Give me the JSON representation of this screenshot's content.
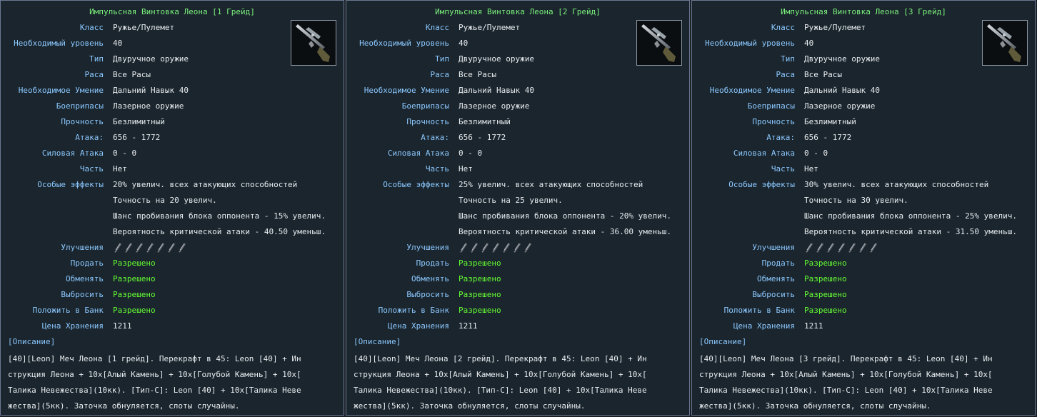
{
  "panels": [
    {
      "title": "Импульсная Винтовка Леона [1 Грейд]",
      "icon": "rifle-icon",
      "rows": [
        {
          "label": "Класс",
          "value": "Ружье/Пулемет"
        },
        {
          "label": "Необходимый уровень",
          "value": "40"
        },
        {
          "label": "Тип",
          "value": "Двуручное оружие"
        },
        {
          "label": "Раса",
          "value": "Все Расы"
        },
        {
          "label": "Необходимое Умение",
          "value": "Дальний Навык 40"
        },
        {
          "label": "Боеприпасы",
          "value": "Лазерное оружие"
        },
        {
          "label": "Прочность",
          "value": "Безлимитный"
        },
        {
          "label": "Атака:",
          "value": "656 - 1772"
        },
        {
          "label": "Силовая Атака",
          "value": "0 - 0"
        },
        {
          "label": "Часть",
          "value": "Нет"
        },
        {
          "label": "Особые эффекты",
          "value": "20% увелич. всех атакующих способностей"
        },
        {
          "label": "",
          "value": "Точность на 20 увелич."
        },
        {
          "label": "",
          "value": "Шанс пробивания блока оппонента - 15% увелич."
        },
        {
          "label": "",
          "value": "Вероятность критической атаки - 40.50 уменьш."
        }
      ],
      "upgrades_label": "Улучшения",
      "upgrade_slots": 7,
      "perm_rows": [
        {
          "label": "Продать",
          "value": "Разрешено"
        },
        {
          "label": "Обменять",
          "value": "Разрешено"
        },
        {
          "label": "Выбросить",
          "value": "Разрешено"
        },
        {
          "label": "Положить в Банк",
          "value": "Разрешено"
        }
      ],
      "storage": {
        "label": "Цена Хранения",
        "value": "1211"
      },
      "desc_header": "[Описание]",
      "desc_lines": [
        "[40][Leon] Меч Леона [1 грейд]. Перекрафт в 45: Leon [40] + Ин",
        "струкция Леона + 10x[Алый Камень] + 10x[Голубой Камень] + 10x[",
        "Талика Невежества](10кк). [Тип-С]: Leon [40] + 10x[Талика Неве",
        "жества](5кк). Заточка обнуляется, слоты случайны."
      ]
    },
    {
      "title": "Импульсная Винтовка Леона [2 Грейд]",
      "icon": "rifle-icon",
      "rows": [
        {
          "label": "Класс",
          "value": "Ружье/Пулемет"
        },
        {
          "label": "Необходимый уровень",
          "value": "40"
        },
        {
          "label": "Тип",
          "value": "Двуручное оружие"
        },
        {
          "label": "Раса",
          "value": "Все Расы"
        },
        {
          "label": "Необходимое Умение",
          "value": "Дальний Навык 40"
        },
        {
          "label": "Боеприпасы",
          "value": "Лазерное оружие"
        },
        {
          "label": "Прочность",
          "value": "Безлимитный"
        },
        {
          "label": "Атака:",
          "value": "656 - 1772"
        },
        {
          "label": "Силовая Атака",
          "value": "0 - 0"
        },
        {
          "label": "Часть",
          "value": "Нет"
        },
        {
          "label": "Особые эффекты",
          "value": "25% увелич. всех атакующих способностей"
        },
        {
          "label": "",
          "value": "Точность на 25 увелич."
        },
        {
          "label": "",
          "value": "Шанс пробивания блока оппонента - 20% увелич."
        },
        {
          "label": "",
          "value": "Вероятность критической атаки - 36.00 уменьш."
        }
      ],
      "upgrades_label": "Улучшения",
      "upgrade_slots": 7,
      "perm_rows": [
        {
          "label": "Продать",
          "value": "Разрешено"
        },
        {
          "label": "Обменять",
          "value": "Разрешено"
        },
        {
          "label": "Выбросить",
          "value": "Разрешено"
        },
        {
          "label": "Положить в Банк",
          "value": "Разрешено"
        }
      ],
      "storage": {
        "label": "Цена Хранения",
        "value": "1211"
      },
      "desc_header": "[Описание]",
      "desc_lines": [
        "[40][Leon] Меч Леона [2 грейд]. Перекрафт в 45: Leon [40] + Ин",
        "струкция Леона + 10x[Алый Камень] + 10x[Голубой Камень] + 10x[",
        "Талика Невежества](10кк). [Тип-С]: Leon [40] + 10x[Талика Неве",
        "жества](5кк). Заточка обнуляется, слоты случайны."
      ]
    },
    {
      "title": "Импульсная Винтовка Леона [3 Грейд]",
      "icon": "rifle-icon",
      "rows": [
        {
          "label": "Класс",
          "value": "Ружье/Пулемет"
        },
        {
          "label": "Необходимый уровень",
          "value": "40"
        },
        {
          "label": "Тип",
          "value": "Двуручное оружие"
        },
        {
          "label": "Раса",
          "value": "Все Расы"
        },
        {
          "label": "Необходимое Умение",
          "value": "Дальний Навык 40"
        },
        {
          "label": "Боеприпасы",
          "value": "Лазерное оружие"
        },
        {
          "label": "Прочность",
          "value": "Безлимитный"
        },
        {
          "label": "Атака:",
          "value": "656 - 1772"
        },
        {
          "label": "Силовая Атака",
          "value": "0 - 0"
        },
        {
          "label": "Часть",
          "value": "Нет"
        },
        {
          "label": "Особые эффекты",
          "value": "30% увелич. всех атакующих способностей"
        },
        {
          "label": "",
          "value": "Точность на 30 увелич."
        },
        {
          "label": "",
          "value": "Шанс пробивания блока оппонента - 25% увелич."
        },
        {
          "label": "",
          "value": "Вероятность критической атаки - 31.50 уменьш."
        }
      ],
      "upgrades_label": "Улучшения",
      "upgrade_slots": 7,
      "perm_rows": [
        {
          "label": "Продать",
          "value": "Разрешено"
        },
        {
          "label": "Обменять",
          "value": "Разрешено"
        },
        {
          "label": "Выбросить",
          "value": "Разрешено"
        },
        {
          "label": "Положить в Банк",
          "value": "Разрешено"
        }
      ],
      "storage": {
        "label": "Цена Хранения",
        "value": "1211"
      },
      "desc_header": "[Описание]",
      "desc_lines": [
        "[40][Leon] Меч Леона [3 грейд]. Перекрафт в 45: Leon [40] + Ин",
        "струкция Леона + 10x[Алый Камень] + 10x[Голубой Камень] + 10x[",
        "Талика Невежества](10кк). [Тип-С]: Leon [40] + 10x[Талика Неве",
        "жества](5кк). Заточка обнуляется, слоты случайны."
      ]
    }
  ],
  "colors": {
    "title": "#7cf07c",
    "label": "#8cc8ff",
    "value": "#e8ecef",
    "allowed": "#66ff33",
    "panel_bg": "#1a252d",
    "panel_border": "#6a7890"
  }
}
